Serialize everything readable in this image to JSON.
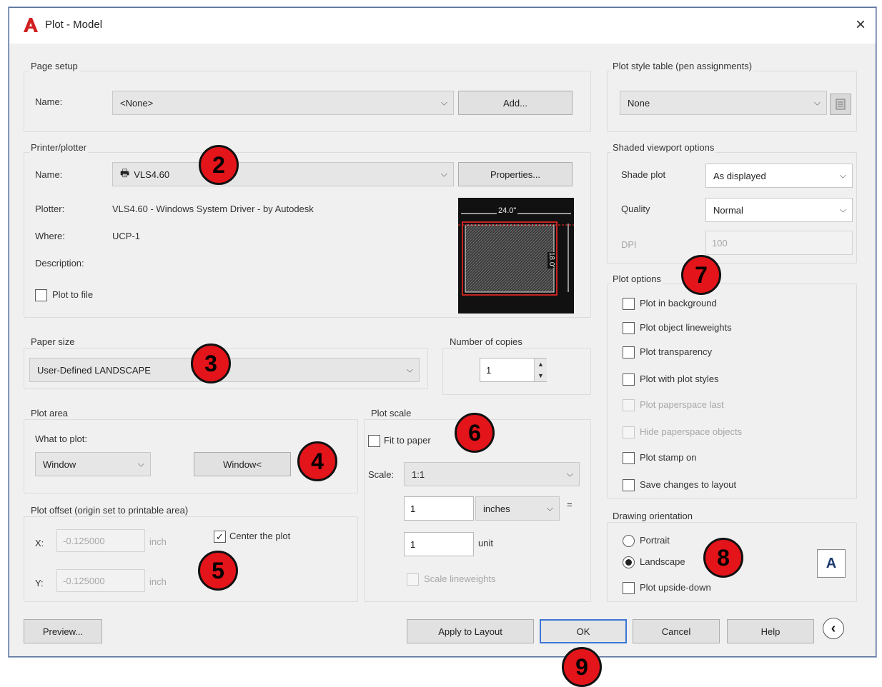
{
  "window": {
    "title": "Plot - Model",
    "close_label": "×"
  },
  "page_setup": {
    "label": "Page setup",
    "name_label": "Name:",
    "name_value": "<None>",
    "add_button": "Add..."
  },
  "printer": {
    "label": "Printer/plotter",
    "name_label": "Name:",
    "name_value": "VLS4.60",
    "properties_button": "Properties...",
    "plotter_label": "Plotter:",
    "plotter_value": "VLS4.60 - Windows System Driver - by Autodesk",
    "where_label": "Where:",
    "where_value": "UCP-1",
    "description_label": "Description:",
    "plot_to_file_label": "Plot to file",
    "preview_width_label": "24.0\"",
    "preview_height_label": "18.0\""
  },
  "paper_size": {
    "label": "Paper size",
    "value": "User-Defined LANDSCAPE"
  },
  "copies": {
    "label": "Number of copies",
    "value": "1"
  },
  "plot_area": {
    "label": "Plot area",
    "what_label": "What to plot:",
    "what_value": "Window",
    "window_button": "Window<"
  },
  "plot_offset": {
    "label": "Plot offset (origin set to printable area)",
    "x_label": "X:",
    "x_value": "-0.125000",
    "y_label": "Y:",
    "y_value": "-0.125000",
    "unit": "inch",
    "center_label": "Center the plot"
  },
  "plot_scale": {
    "label": "Plot scale",
    "fit_label": "Fit to paper",
    "scale_label": "Scale:",
    "scale_value": "1:1",
    "value1": "1",
    "units_value": "inches",
    "equals": "=",
    "value2": "1",
    "unit_label": "unit",
    "lineweights_label": "Scale lineweights"
  },
  "plot_style": {
    "label": "Plot style table (pen assignments)",
    "value": "None"
  },
  "shaded": {
    "label": "Shaded viewport options",
    "shade_label": "Shade plot",
    "shade_value": "As displayed",
    "quality_label": "Quality",
    "quality_value": "Normal",
    "dpi_label": "DPI",
    "dpi_value": "100"
  },
  "plot_options": {
    "label": "Plot options",
    "items": [
      "Plot in background",
      "Plot object lineweights",
      "Plot transparency",
      "Plot with plot styles",
      "Plot paperspace last",
      "Hide paperspace objects",
      "Plot stamp on",
      "Save changes to layout"
    ]
  },
  "orientation": {
    "label": "Drawing orientation",
    "portrait": "Portrait",
    "landscape": "Landscape",
    "upside_down": "Plot upside-down",
    "icon_letter": "A"
  },
  "footer": {
    "preview": "Preview...",
    "apply": "Apply to Layout",
    "ok": "OK",
    "cancel": "Cancel",
    "help": "Help",
    "collapse": "‹"
  },
  "badges": [
    "2",
    "3",
    "4",
    "5",
    "6",
    "7",
    "8",
    "9"
  ],
  "colors": {
    "badge": "#e3141a",
    "accent": "#3b77d6",
    "logo": "#d22020"
  }
}
